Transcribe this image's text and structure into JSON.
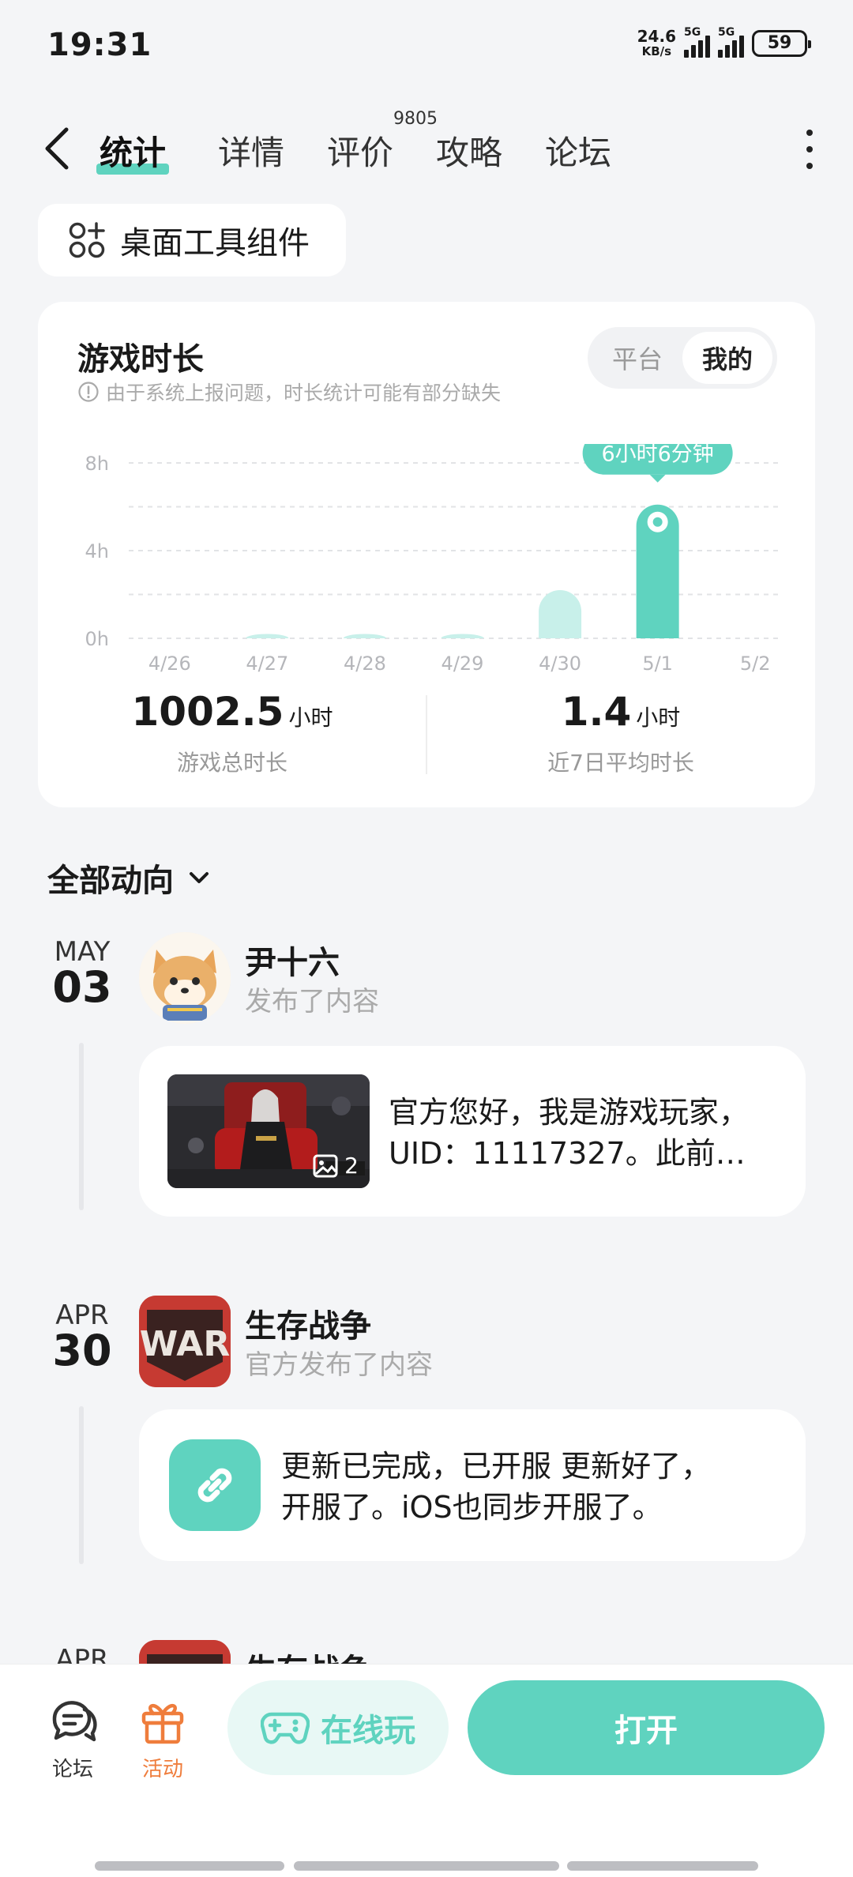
{
  "status_bar": {
    "time": "19:31",
    "net_speed_value": "24.6",
    "net_speed_unit": "KB/s",
    "sim1_label": "5G",
    "sim2_label": "5G",
    "battery": "59"
  },
  "nav": {
    "tabs": [
      {
        "label": "统计"
      },
      {
        "label": "详情"
      },
      {
        "label": "评价"
      },
      {
        "label": "攻略"
      },
      {
        "label": "论坛"
      }
    ],
    "review_count": "9805"
  },
  "widget_button": {
    "label": "桌面工具组件"
  },
  "stats": {
    "title": "游戏时长",
    "note": "由于系统上报问题，时长统计可能有部分缺失",
    "toggle": {
      "options": [
        "平台",
        "我的"
      ],
      "selected": "我的"
    },
    "total_value": "1002.5",
    "total_unit": "小时",
    "total_label": "游戏总时长",
    "avg_value": "1.4",
    "avg_unit": "小时",
    "avg_label": "近7日平均时长"
  },
  "chart_data": {
    "type": "bar",
    "categories": [
      "4/26",
      "4/27",
      "4/28",
      "4/29",
      "4/30",
      "5/1",
      "5/2"
    ],
    "values": [
      0,
      0.2,
      0.2,
      0.2,
      2.2,
      6.1,
      0
    ],
    "unit": "h",
    "yticks": [
      "0h",
      "4h",
      "8h"
    ],
    "ylim": [
      0,
      8
    ],
    "highlight_index": 5,
    "highlight_label": "6小时6分钟",
    "colors": {
      "highlight": "#5fd3bf",
      "normal": "#c8f0ea"
    },
    "grid": true
  },
  "feed": {
    "filter_label": "全部动向",
    "items": [
      {
        "month": "MAY",
        "day": "03",
        "author": "尹十六",
        "action": "发布了内容",
        "image_count": "2",
        "text_line1": "官方您好，我是游戏玩家，",
        "text_line2": "UID：11117327。此前…"
      },
      {
        "month": "APR",
        "day": "30",
        "author": "生存战争",
        "action": "官方发布了内容",
        "text_line1": "更新已完成，已开服 更新好了，",
        "text_line2": "开服了。iOS也同步开服了。"
      },
      {
        "month": "APR",
        "author": "生存战争"
      }
    ]
  },
  "bottom_bar": {
    "forum_label": "论坛",
    "activity_label": "活动",
    "play_online_label": "在线玩",
    "open_label": "打开",
    "accent_color": "#5fd3bf",
    "activity_color": "#ef7d3c"
  }
}
